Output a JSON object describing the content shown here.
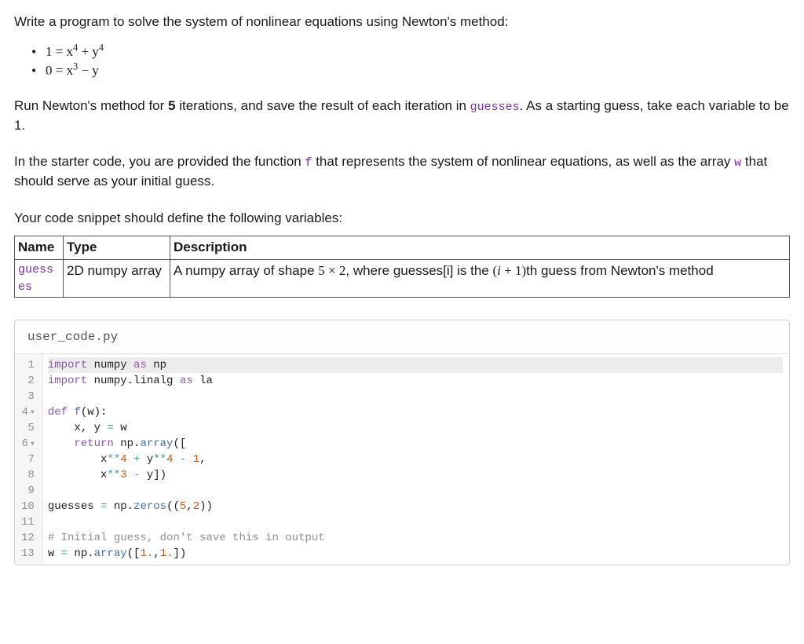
{
  "intro": "Write a program to solve the system of nonlinear equations using Newton's method:",
  "equations": [
    {
      "lhs": "1",
      "rhs_html": "x<sup>4</sup> + y<sup>4</sup>"
    },
    {
      "lhs": "0",
      "rhs_html": "x<sup>3</sup> − y"
    }
  ],
  "p1_pre": "Run Newton's method for ",
  "p1_bold": "5",
  "p1_mid": " iterations, and save the result of each iteration in ",
  "p1_code": "guesses",
  "p1_post": ". As a starting guess, take each variable to be 1.",
  "p2_pre": "In the starter code, you are provided the function ",
  "p2_code1": "f",
  "p2_mid": " that represents the system of nonlinear equations, as well as the array ",
  "p2_code2": "w",
  "p2_post": " that should serve as your initial guess.",
  "p3": "Your code snippet should define the following variables:",
  "table": {
    "headers": [
      "Name",
      "Type",
      "Description"
    ],
    "row": {
      "name": "guesses",
      "type": "2D numpy array",
      "desc_pre": "A numpy array of shape ",
      "desc_shape": "5 × 2",
      "desc_mid": ", where guesses[i] is the ",
      "desc_math_open": "(",
      "desc_math_i": "i",
      "desc_math_plus": " + 1)",
      "desc_suffix": "th guess from Newton's method"
    }
  },
  "code": {
    "filename": "user_code.py",
    "lines": [
      {
        "n": "1",
        "fold": false,
        "hl": true,
        "html": "<span class='kw'>import</span> numpy <span class='kw'>as</span> np"
      },
      {
        "n": "2",
        "fold": false,
        "hl": false,
        "html": "<span class='kw'>import</span> numpy.linalg <span class='kw'>as</span> la"
      },
      {
        "n": "3",
        "fold": false,
        "hl": false,
        "html": ""
      },
      {
        "n": "4",
        "fold": true,
        "hl": false,
        "html": "<span class='kw'>def</span> <span class='def'>f</span>(w):"
      },
      {
        "n": "5",
        "fold": false,
        "hl": false,
        "html": "    x, y <span class='op'>=</span> w"
      },
      {
        "n": "6",
        "fold": true,
        "hl": false,
        "html": "    <span class='kw'>return</span> np.<span class='fn'>array</span>(["
      },
      {
        "n": "7",
        "fold": false,
        "hl": false,
        "html": "        x<span class='op'>**</span><span class='num'>4</span> <span class='op'>+</span> y<span class='op'>**</span><span class='num'>4</span> <span class='op'>-</span> <span class='num'>1</span>,"
      },
      {
        "n": "8",
        "fold": false,
        "hl": false,
        "html": "        x<span class='op'>**</span><span class='num'>3</span> <span class='op'>-</span> y])"
      },
      {
        "n": "9",
        "fold": false,
        "hl": false,
        "html": ""
      },
      {
        "n": "10",
        "fold": false,
        "hl": false,
        "html": "guesses <span class='op'>=</span> np.<span class='fn'>zeros</span>((<span class='num'>5</span>,<span class='num'>2</span>))"
      },
      {
        "n": "11",
        "fold": false,
        "hl": false,
        "html": ""
      },
      {
        "n": "12",
        "fold": false,
        "hl": false,
        "html": "<span class='comment'># Initial guess, don't save this in output</span>"
      },
      {
        "n": "13",
        "fold": false,
        "hl": false,
        "html": "w <span class='op'>=</span> np.<span class='fn'>array</span>([<span class='num'>1.</span>,<span class='num'>1.</span>])"
      }
    ]
  }
}
